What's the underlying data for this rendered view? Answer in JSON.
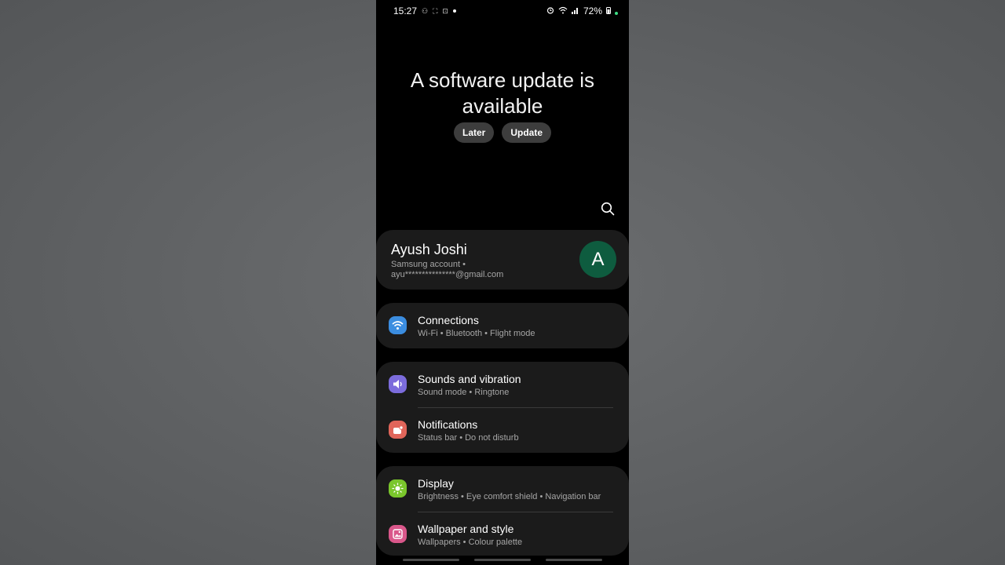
{
  "status_bar": {
    "time": "15:27",
    "battery": "72%",
    "left_icons": [
      "usb-debug-icon",
      "screenshot-icon",
      "screen-record-icon",
      "notification-dot-icon"
    ],
    "right_icons": [
      "alarm-icon",
      "wifi-icon",
      "signal-icon",
      "battery-icon"
    ]
  },
  "banner": {
    "title": "A software update is available",
    "later_label": "Later",
    "update_label": "Update"
  },
  "account": {
    "name": "Ayush Joshi",
    "subtitle": "Samsung account  •  ayu***************@gmail.com",
    "avatar_letter": "A",
    "avatar_color": "#0e5c3f"
  },
  "settings": [
    {
      "title": "Connections",
      "subtitle": "Wi-Fi  •  Bluetooth  •  Flight mode",
      "icon": "wifi-icon",
      "color": "#3b8de0"
    },
    {
      "title": "Sounds and vibration",
      "subtitle": "Sound mode  •  Ringtone",
      "icon": "volume-icon",
      "color": "#7c6cdc"
    },
    {
      "title": "Notifications",
      "subtitle": "Status bar  •  Do not disturb",
      "icon": "notification-icon",
      "color": "#e0655a"
    },
    {
      "title": "Display",
      "subtitle": "Brightness  •  Eye comfort shield  •  Navigation bar",
      "icon": "sun-icon",
      "color": "#7ac62c"
    },
    {
      "title": "Wallpaper and style",
      "subtitle": "Wallpapers  •  Colour palette",
      "icon": "wallpaper-icon",
      "color": "#d9578a"
    }
  ]
}
